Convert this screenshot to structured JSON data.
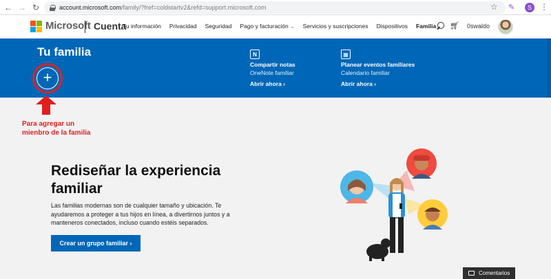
{
  "browser": {
    "url_host": "account.microsoft.com",
    "url_path": "/family/?fref=coldstartv2&refd=support.microsoft.com",
    "profile_initial": "S"
  },
  "header": {
    "brand": "Microsoft",
    "section": "Cuenta",
    "nav": [
      "Tu información",
      "Privacidad",
      "Seguridad",
      "Pago y facturación",
      "Servicios y suscripciones",
      "Dispositivos",
      "Familia"
    ],
    "user_name": "0swaldo"
  },
  "banner": {
    "title": "Tu familia",
    "add_symbol": "+",
    "promos": [
      {
        "icon": "N",
        "title": "Compartir notas",
        "subtitle": "OneNote familiar",
        "link": "Abrir ahora ›"
      },
      {
        "icon": "▦",
        "title": "Planear eventos familiares",
        "subtitle": "Calendario familiar",
        "link": "Abrir ahora ›"
      }
    ]
  },
  "annotation": {
    "text": "Para agregar un mienbro de la familia",
    "color": "#e02020"
  },
  "hero": {
    "title": "Rediseñar la experiencia familiar",
    "body": "Las familias modernas son de cualquier tamaño y ubicación. Te ayudaremos a proteger a tus hijos en línea, a divertirnos juntos y a manteneros conectados, incluso cuando estéis separados.",
    "cta": "Crear un grupo familiar ›"
  },
  "feedback": {
    "label": "Comentarios"
  },
  "colors": {
    "accent": "#0067b8",
    "annotation": "#e02020"
  }
}
